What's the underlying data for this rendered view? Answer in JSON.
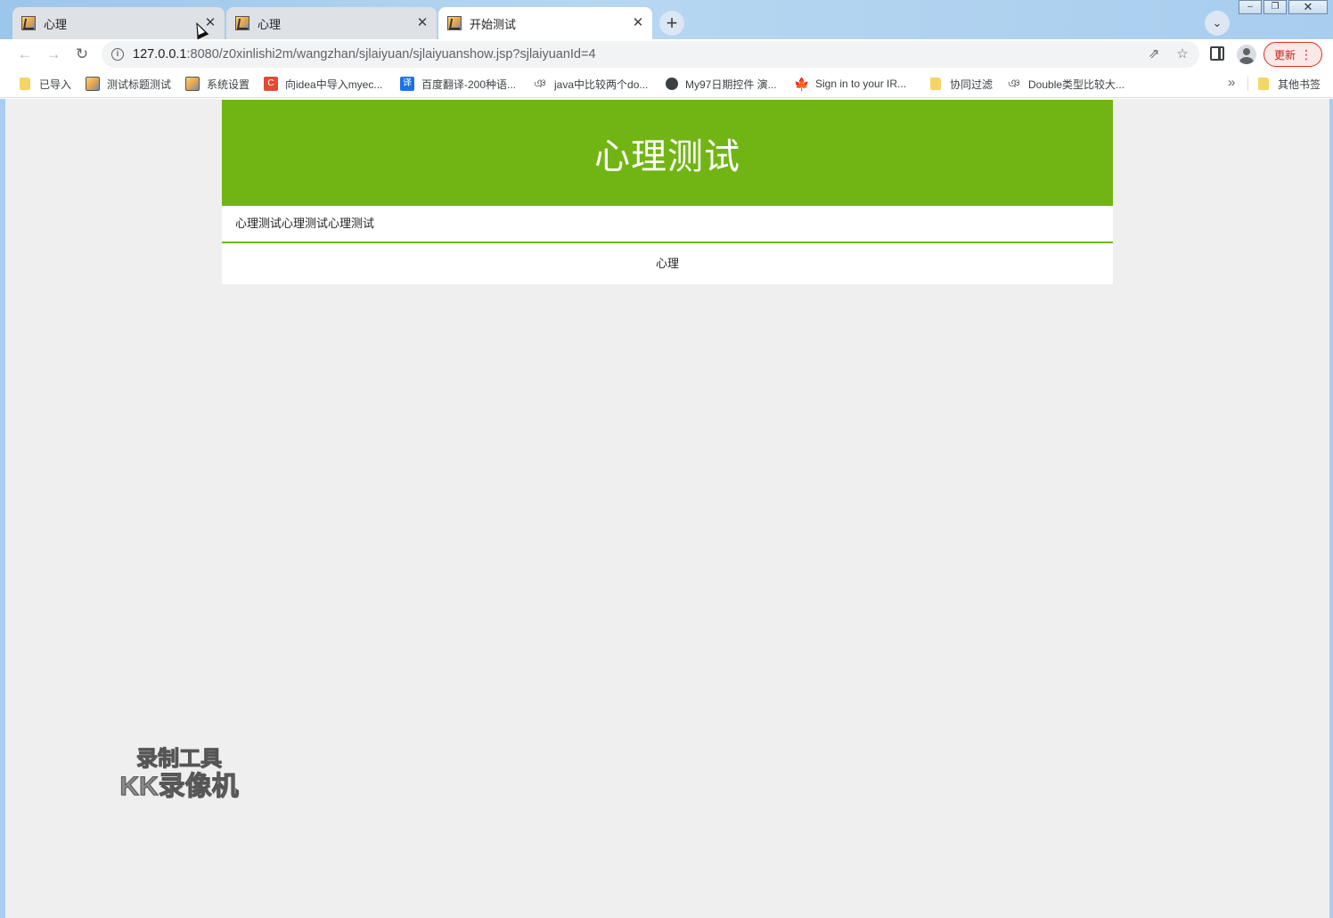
{
  "browser": {
    "tabs": [
      {
        "title": "心理",
        "active": false
      },
      {
        "title": "心理",
        "active": false
      },
      {
        "title": "开始测试",
        "active": true
      }
    ],
    "tab_close_glyph": "✕",
    "new_tab_glyph": "+",
    "tab_search_glyph": "⌄",
    "window_controls": {
      "minimize": "–",
      "restore": "❐",
      "close": "✕"
    },
    "nav": {
      "back": "←",
      "forward": "→",
      "reload": "↻"
    },
    "url": {
      "host": "127.0.0.1",
      "rest": ":8080/z0xinlishi2m/wangzhan/sjlaiyuan/sjlaiyuanshow.jsp?sjlaiyuanId=4"
    },
    "info_glyph": "i",
    "share_glyph": "⇗",
    "star_glyph": "☆",
    "update_label": "更新",
    "menu_glyph": "⋮",
    "bookmarks": [
      {
        "label": "已导入",
        "icon": "folder-icon"
      },
      {
        "label": "测试标题测试",
        "icon": "page-image-icon"
      },
      {
        "label": "系统设置",
        "icon": "page-image-icon"
      },
      {
        "label": "向idea中导入myec...",
        "icon": "c-logo-icon"
      },
      {
        "label": "百度翻译-200种语...",
        "icon": "translate-icon"
      },
      {
        "label": "java中比较两个do...",
        "icon": "hook-icon"
      },
      {
        "label": "My97日期控件 演...",
        "icon": "globe-icon"
      },
      {
        "label": "Sign in to your IR...",
        "icon": "maple-leaf-icon"
      },
      {
        "label": "协同过滤",
        "icon": "folder-icon"
      },
      {
        "label": "Double类型比较大...",
        "icon": "hook-icon"
      }
    ],
    "bookmarks_overflow": "»",
    "other_bookmarks": "其他书签",
    "icon_glyphs": {
      "translate": "译",
      "c_logo": "C",
      "hook": "ঞ",
      "maple": "🍁"
    }
  },
  "page": {
    "header_title": "心理测试",
    "subtitle": "心理测试心理测试心理测试",
    "content": "心理"
  },
  "watermark": {
    "line1": "录制工具",
    "line2": "KK录像机"
  },
  "colors": {
    "header_green": "#71b514",
    "page_bg": "#efefef",
    "update_red": "#d93025"
  }
}
